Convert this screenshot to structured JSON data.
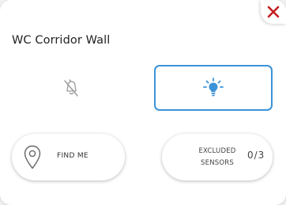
{
  "panel": {
    "title": "WC Corridor Wall"
  },
  "controls": {
    "close_icon": "close-icon",
    "mode_off_icon": "light-off-icon",
    "mode_on_icon": "lightbulb-on-icon",
    "mode_on_selected": true
  },
  "find_me": {
    "icon": "location-pin-icon",
    "label": "FIND ME"
  },
  "excluded_sensors": {
    "label_line1": "EXCLUDED",
    "label_line2": "SENSORS",
    "count": "0/3"
  },
  "colors": {
    "close": "#c41e1e",
    "accent": "#3b93d9",
    "icon_grey": "#9a9a9a"
  }
}
